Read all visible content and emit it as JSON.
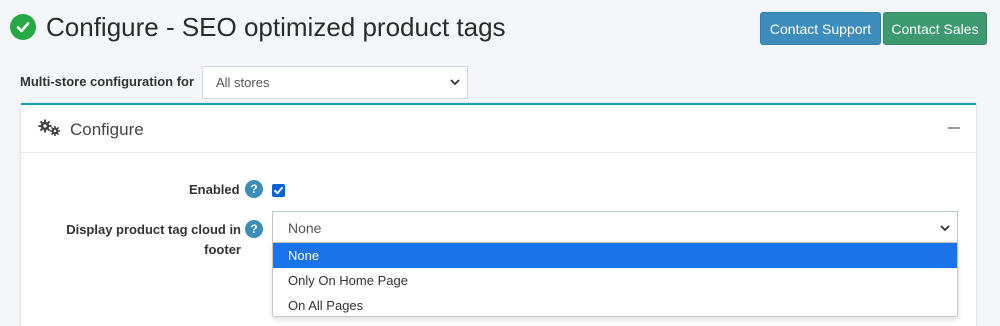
{
  "header": {
    "title": "Configure - SEO optimized product tags",
    "contact_support": "Contact Support",
    "contact_sales": "Contact Sales"
  },
  "store": {
    "label": "Multi-store configuration for",
    "selected": "All stores"
  },
  "card": {
    "title": "Configure",
    "enabled_label": "Enabled",
    "enabled_checked": true,
    "tag_cloud_label": "Display product tag cloud in footer",
    "tag_cloud_selected": "None",
    "options": [
      "None",
      "Only On Home Page",
      "On All Pages"
    ],
    "highlighted_option": "None"
  },
  "colors": {
    "success": "#28a745",
    "primary": "#3c8dbc",
    "sales": "#3d9970",
    "card_border": "#17a2b8",
    "option_highlight": "#1a73e8"
  }
}
